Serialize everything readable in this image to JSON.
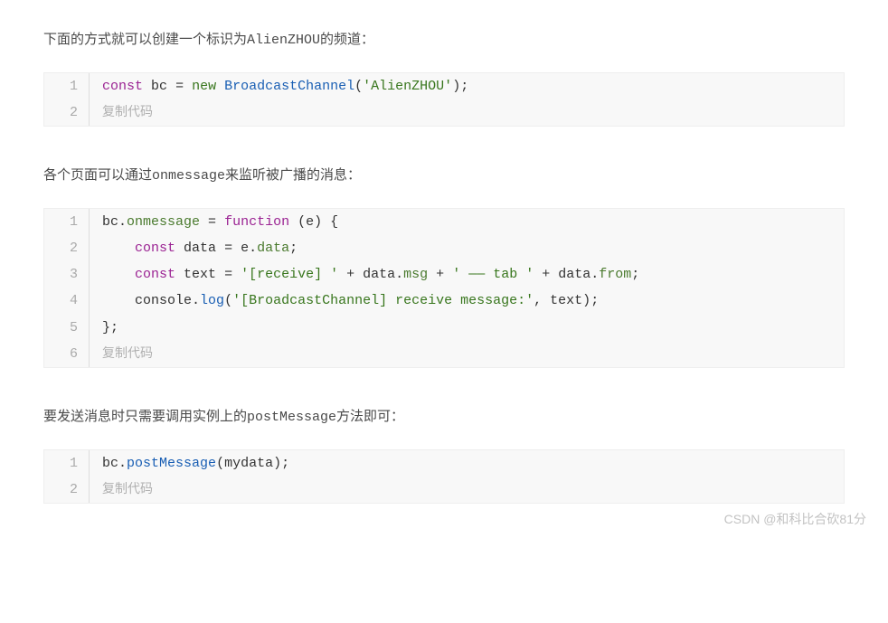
{
  "paragraph1": {
    "pre": "下面的方式就可以创建一个标识为",
    "code": "AlienZHOU",
    "post": "的频道："
  },
  "code1": {
    "copy_label": "复制代码",
    "tokens": {
      "const": "const",
      "bc": "bc",
      "eq": "=",
      "new": "new",
      "type": "BroadcastChannel",
      "lparen": "(",
      "str": "'AlienZHOU'",
      "rparen": ")",
      "semi": ";"
    }
  },
  "paragraph2": {
    "pre": "各个页面可以通过",
    "code": "onmessage",
    "post": "来监听被广播的消息："
  },
  "code2": {
    "copy_label": "复制代码",
    "line1": {
      "bc": "bc",
      "dot": ".",
      "onmessage": "onmessage",
      "eq": " = ",
      "function": "function",
      "space": " ",
      "lparen": "(",
      "e": "e",
      "rparen": ")",
      "space2": " ",
      "lbrace": "{"
    },
    "line2": {
      "indent": "    ",
      "const": "const",
      "sp": " ",
      "data": "data",
      "eq": " = ",
      "e": "e",
      "dot": ".",
      "prop": "data",
      "semi": ";"
    },
    "line3": {
      "indent": "    ",
      "const": "const",
      "sp": " ",
      "text": "text",
      "eq": " = ",
      "str1": "'[receive] '",
      "plus1": " + ",
      "data": "data",
      "dot1": ".",
      "msg": "msg",
      "plus2": " + ",
      "str2": "' —— tab '",
      "plus3": " + ",
      "data2": "data",
      "dot2": ".",
      "from": "from",
      "semi": ";"
    },
    "line4": {
      "indent": "    ",
      "console": "console",
      "dot": ".",
      "log": "log",
      "lparen": "(",
      "str": "'[BroadcastChannel] receive message:'",
      "comma": ", ",
      "text": "text",
      "rparen": ")",
      "semi": ";"
    },
    "line5": {
      "rbrace": "}",
      "semi": ";"
    }
  },
  "paragraph3": {
    "pre": "要发送消息时只需要调用实例上的",
    "code": "postMessage",
    "post": "方法即可："
  },
  "code3": {
    "copy_label": "复制代码",
    "tokens": {
      "bc": "bc",
      "dot": ".",
      "method": "postMessage",
      "lparen": "(",
      "arg": "mydata",
      "rparen": ")",
      "semi": ";"
    }
  },
  "watermark": "CSDN @和科比合砍81分"
}
